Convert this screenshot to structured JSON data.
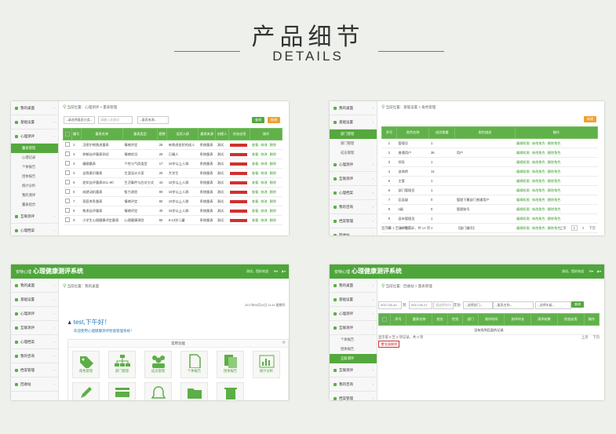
{
  "header": {
    "title": "产品细节",
    "subtitle": "DETAILS"
  },
  "p1": {
    "crumb": "当前位置：心理测评 > 量表管理",
    "sidebar": [
      {
        "label": "我的桌面"
      },
      {
        "label": "基础设置"
      },
      {
        "label": "心理测评"
      }
    ],
    "subs": [
      {
        "label": "量表管理"
      },
      {
        "label": "心理记录"
      },
      {
        "label": "个体报告"
      },
      {
        "label": "团体报告"
      },
      {
        "label": "统计分析"
      },
      {
        "label": "我的测评"
      },
      {
        "label": "量表组合"
      }
    ],
    "sidebar_bottom": [
      {
        "label": "互联测评"
      },
      {
        "label": "心理档案"
      },
      {
        "label": "我的咨询"
      }
    ],
    "filters": [
      "--请选择量表分类--",
      "--请选择--",
      "--量表来源--"
    ],
    "search_placeholder": "请输入关键词",
    "btn_search": "查询",
    "btn_add": "新增",
    "cols": [
      "",
      "编号",
      "量表名称",
      "量表类型",
      "题数",
      "适用人群",
      "量表来源",
      "创建人",
      "状态启用",
      "操作"
    ],
    "rows": [
      [
        "1",
        "汉密尔顿焦虑量表",
        "情绪评定",
        "25",
        "有焦虑症状的成人",
        "系统量表",
        "测试"
      ],
      [
        "2",
        "抑郁自评量表测试",
        "情绪状况",
        "25",
        "已婚人",
        "系统量表",
        "测试"
      ],
      [
        "3",
        "婚姻量表",
        "个性与气质类型",
        "17",
        "18岁以上人群",
        "系统量表",
        "测试"
      ],
      [
        "4",
        "自我意识量表",
        "生涯设计方案",
        "20",
        "大学生",
        "系统量表",
        "测试"
      ],
      [
        "5",
        "症状自评量表SCL-90",
        "生活事件与应对方式",
        "44",
        "18岁以上人群",
        "系统量表",
        "测试"
      ],
      [
        "6",
        "成就动机量表",
        "智力测验",
        "90",
        "18岁以上人群",
        "系统量表",
        "测试"
      ],
      [
        "7",
        "家庭关系量表",
        "情绪评定",
        "60",
        "18岁以上人群",
        "系统量表",
        "测试"
      ],
      [
        "8",
        "焦虑自评量表",
        "情绪评定",
        "40",
        "18岁以上人群",
        "系统量表",
        "测试"
      ],
      [
        "9",
        "小学生心理健康评定量表",
        "心理健康测验",
        "60",
        "6-13岁儿童",
        "系统量表",
        "测试"
      ]
    ],
    "ops": [
      "查看",
      "修改",
      "删除"
    ]
  },
  "p2": {
    "crumb": "当前位置：基础设置 > 角色管理",
    "sidebar_top": [
      {
        "label": "我的桌面"
      },
      {
        "label": "基础设置"
      }
    ],
    "subs": [
      {
        "label": "部门管理"
      },
      {
        "label": "部门管理"
      },
      {
        "label": "成员管理"
      }
    ],
    "sidebar_bottom": [
      {
        "label": "心理测评"
      },
      {
        "label": "互联测评"
      },
      {
        "label": "心理档案"
      },
      {
        "label": "我的咨询"
      },
      {
        "label": "档案管理"
      },
      {
        "label": "回收站"
      }
    ],
    "btn_add": "新增",
    "cols": [
      "序号",
      "角色名称",
      "成员数量",
      "角色描述",
      "操作"
    ],
    "rows": [
      [
        "1",
        "管理员",
        "1",
        ""
      ],
      [
        "2",
        "普通用户",
        "36",
        "用户"
      ],
      [
        "3",
        "领导",
        "1",
        ""
      ],
      [
        "4",
        "咨询师",
        "14",
        ""
      ],
      [
        "5",
        "主管",
        "1",
        ""
      ],
      [
        "6",
        "部门管理员",
        "1",
        ""
      ],
      [
        "7",
        "区县级",
        "0",
        "管理下属部门普通用户"
      ],
      [
        "8",
        "1级",
        "0",
        "管理账号"
      ],
      [
        "9",
        "县市管理员",
        "1",
        ""
      ],
      [
        "10",
        "测评账号",
        "1",
        "【部门编号】"
      ]
    ],
    "ops": [
      "编辑权限",
      "修改角色",
      "删除角色"
    ],
    "footer": "显示第 1 至 10 项记录，共 14 项",
    "pager": [
      "上页",
      "1",
      "2",
      "下页"
    ]
  },
  "p3": {
    "logo_small": "安特心理",
    "logo": "心理健康测评系统",
    "user": "测试，您好欢迎",
    "crumb": "当前位置：我的桌面",
    "time": "2017年05月14日 11:41 星期四",
    "sidebar": [
      {
        "label": "我的桌面"
      },
      {
        "label": "基础设置"
      },
      {
        "label": "心理测评"
      },
      {
        "label": "互联测评"
      },
      {
        "label": "心理档案"
      },
      {
        "label": "我的咨询"
      },
      {
        "label": "档案管理"
      },
      {
        "label": "回收站"
      }
    ],
    "greet": "test,下午好！",
    "welcome": "欢迎使用心理健康测评智能管理系统！",
    "section": "常用功能",
    "tiles": [
      {
        "label": "角色管理",
        "icon": "tag-icon"
      },
      {
        "label": "部门管理",
        "icon": "org-icon"
      },
      {
        "label": "成员管理",
        "icon": "users-icon"
      },
      {
        "label": "个体报告",
        "icon": "document-icon"
      },
      {
        "label": "团体报告",
        "icon": "documents-icon"
      },
      {
        "label": "统计分析",
        "icon": "chart-icon"
      },
      {
        "label": "",
        "icon": "pencil-icon"
      },
      {
        "label": "",
        "icon": "card-icon"
      },
      {
        "label": "",
        "icon": "bell-icon"
      },
      {
        "label": "",
        "icon": "folder-icon"
      },
      {
        "label": "",
        "icon": "trash-icon"
      }
    ]
  },
  "p4": {
    "logo_small": "安特心理",
    "logo": "心理健康测评系统",
    "user": "测试，您好欢迎",
    "crumb": "当前位置：回收站 > 量表管理",
    "date_from": "2017-05-10",
    "date_to": "2017-05-17",
    "filter_labels": [
      "到",
      "年份"
    ],
    "selects": [
      "请选择年份",
      "--选择部门--",
      "--量表名称--",
      "--选择年级--"
    ],
    "btn_query": "查询",
    "sidebar_top": [
      {
        "label": "我的桌面"
      },
      {
        "label": "基础设置"
      },
      {
        "label": "心理测评"
      },
      {
        "label": "互联测评"
      }
    ],
    "subs": [
      {
        "label": "个体报告"
      },
      {
        "label": "团体报告"
      },
      {
        "label": "互联测评"
      }
    ],
    "sidebar_bottom": [
      {
        "label": "互联测评"
      },
      {
        "label": "我的咨询"
      },
      {
        "label": "档案管理"
      },
      {
        "label": "回收站"
      }
    ],
    "cols": [
      "",
      "序号",
      "量表名称",
      "姓名",
      "性别",
      "部门",
      "测评时间",
      "测评时长",
      "测评结果",
      "状态启用",
      "操作"
    ],
    "empty": "没有找到匹配的记录",
    "footer": "显示第 0 至 0 项记录，共 0 项",
    "pager": [
      "上页",
      "下页"
    ],
    "btn_delete": "批量删除"
  }
}
